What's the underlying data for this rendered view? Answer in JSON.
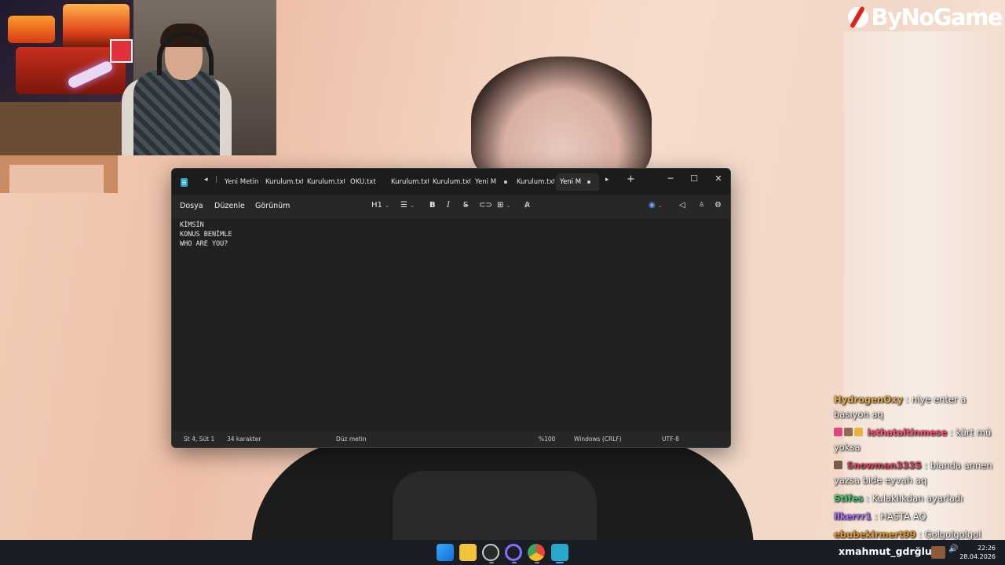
{
  "logo": {
    "text": "ByNoGame"
  },
  "webcam": {
    "overlay_text": ""
  },
  "window": {
    "tabs": [
      {
        "label": "Yeni Metin B",
        "active": false,
        "dot": false
      },
      {
        "label": "Kurulum.txt",
        "active": false,
        "dot": false
      },
      {
        "label": "Kurulum.txt",
        "active": false,
        "dot": false
      },
      {
        "label": "OKU.txt",
        "active": false,
        "dot": false
      },
      {
        "label": "Kurulum.txt",
        "active": false,
        "dot": false
      },
      {
        "label": "Kurulum.txt",
        "active": false,
        "dot": false
      },
      {
        "label": "Yeni M",
        "active": false,
        "dot": true
      },
      {
        "label": "Kurulum.txt",
        "active": false,
        "dot": false
      },
      {
        "label": "Yeni M",
        "active": true,
        "dot": true
      }
    ],
    "menu": {
      "file": "Dosya",
      "edit": "Düzenle",
      "view": "Görünüm"
    },
    "toolbar": {
      "heading": "H1",
      "bold": "B",
      "italic": "I",
      "strike": "S"
    },
    "content_lines": [
      "KİMSİN",
      "KONUS BENİMLE",
      "WHO ARE YOU?"
    ],
    "status": {
      "position": "St 4, Süt 1",
      "chars": "34 karakter",
      "format": "Düz metin",
      "zoom": "%100",
      "line_ending": "Windows (CRLF)",
      "encoding": "UTF-8"
    }
  },
  "chat": [
    {
      "user": "HydrogenOxy",
      "text": ": niye enter a basıyon aq",
      "color": "#e8b04a"
    },
    {
      "user": "isthataltinmese",
      "text": ": kürt mü yoksa",
      "color": "#ff4f7a"
    },
    {
      "user": "Snowman3335",
      "text": ": bianda annen yazsa bide eyvah aq",
      "color": "#d9445a"
    },
    {
      "user": "Stifes",
      "text": ": Kulaklıkdan ayarladı",
      "color": "#3fd27a"
    },
    {
      "user": "ilkerrr1",
      "text": ": HASTA AQ",
      "color": "#b16cff"
    },
    {
      "user": "ebubekirmert99",
      "text": ": Golgolgolgol",
      "color": "#e59a2f"
    }
  ],
  "taskbar": {
    "user": "xmahmut_gdrğlux :",
    "time": "22:26",
    "date": "28.04.2026"
  }
}
